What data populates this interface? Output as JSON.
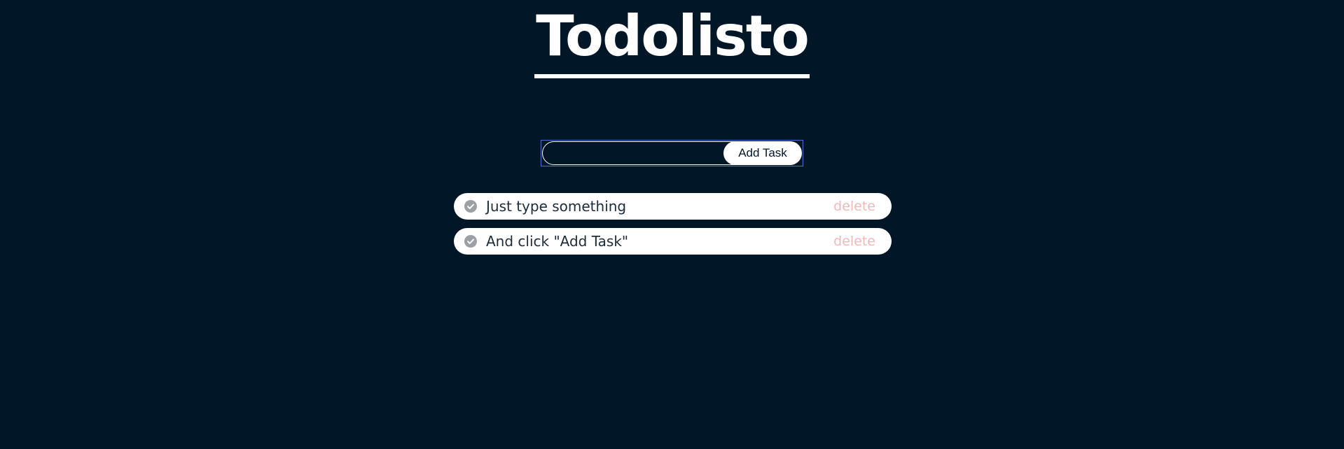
{
  "app": {
    "title": "Todolisto"
  },
  "form": {
    "input_value": "",
    "input_placeholder": "",
    "add_button_label": "Add Task"
  },
  "tasks": [
    {
      "text": "Just type something",
      "delete_label": "delete",
      "check_icon": "check-circle-icon"
    },
    {
      "text": "And click \"Add Task\"",
      "delete_label": "delete",
      "check_icon": "check-circle-icon"
    }
  ],
  "colors": {
    "background": "#011627",
    "text_light": "#ffffff",
    "task_text": "#1d2b3a",
    "delete_text": "#f2b8b8",
    "check_icon": "#9aa0a6",
    "focus_outline": "#4a6fd3"
  }
}
